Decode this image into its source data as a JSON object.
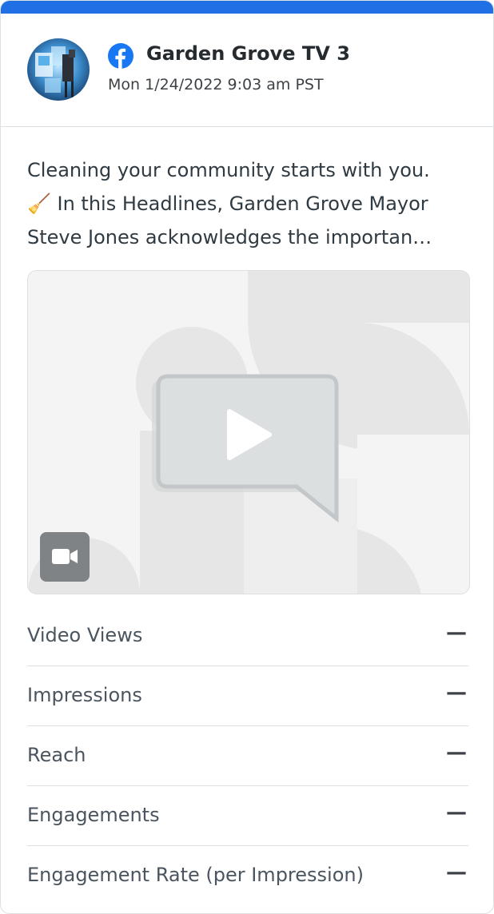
{
  "post": {
    "account_name": "Garden Grove TV 3",
    "timestamp": "Mon 1/24/2022 9:03 am PST",
    "network_icon": "facebook-icon",
    "text_lines": [
      "Cleaning your community starts with you.",
      "🧹 In this Headlines, Garden Grove Mayor",
      "Steve Jones acknowledges the importan…"
    ],
    "media_type_icon": "video-camera-icon"
  },
  "metrics": [
    {
      "label": "Video Views",
      "value": "—"
    },
    {
      "label": "Impressions",
      "value": "—"
    },
    {
      "label": "Reach",
      "value": "—"
    },
    {
      "label": "Engagements",
      "value": "—"
    },
    {
      "label": "Engagement Rate (per Impression)",
      "value": "—"
    }
  ],
  "colors": {
    "accent_bar": "#1f6fe5",
    "facebook_blue": "#1877f2"
  }
}
